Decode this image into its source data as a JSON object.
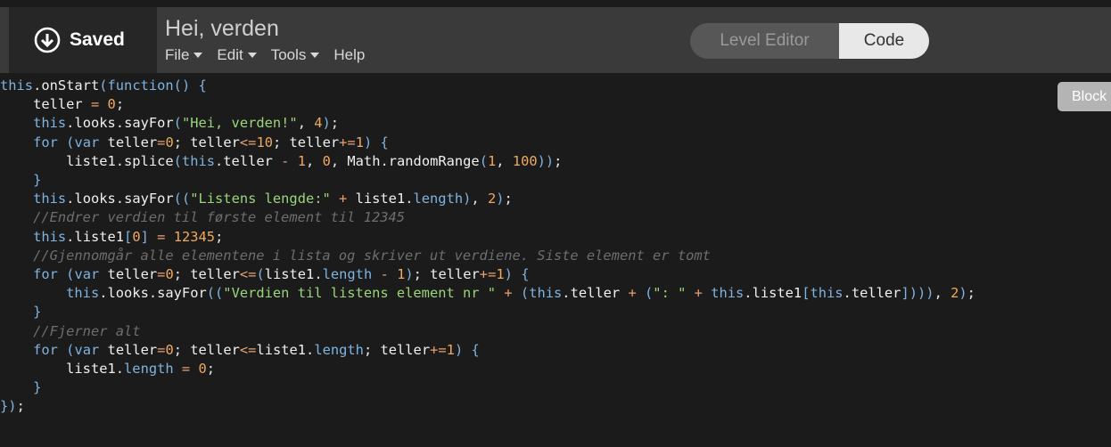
{
  "header": {
    "save_label": "Saved",
    "title": "Hei, verden",
    "menu": [
      {
        "label": "File",
        "has_caret": true
      },
      {
        "label": "Edit",
        "has_caret": true
      },
      {
        "label": "Tools",
        "has_caret": true
      },
      {
        "label": "Help",
        "has_caret": false
      }
    ],
    "toggle": {
      "level_editor": "Level Editor",
      "code": "Code",
      "active": "Code"
    }
  },
  "blocks_button": "Block",
  "code_lines": [
    "this.onStart(function() {",
    "    teller = 0;",
    "    this.looks.sayFor(\"Hei, verden!\", 4);",
    "    for (var teller=0; teller<=10; teller+=1) {",
    "        liste1.splice(this.teller - 1, 0, Math.randomRange(1, 100));",
    "    }",
    "    this.looks.sayFor((\"Listens lengde:\" + liste1.length), 2);",
    "    //Endrer verdien til første element til 12345",
    "    this.liste1[0] = 12345;",
    "    //Gjennomgår alle elementene i lista og skriver ut verdiene. Siste element er tomt",
    "    for (var teller=0; teller<=(liste1.length - 1); teller+=1) {",
    "        this.looks.sayFor((\"Verdien til listens element nr \" + (this.teller + (\": \" + this.liste1[this.teller]))), 2);",
    "    }",
    "    //Fjerner alt",
    "    for (var teller=0; teller<=liste1.length; teller+=1) {",
    "        liste1.length = 0;",
    "    }",
    "});"
  ],
  "colors": {
    "background": "#1b1b1b",
    "topbar": "#3a3a3a",
    "keyword": "#7fb3e0",
    "string": "#9bd57a",
    "number": "#f0a95e",
    "comment": "#6e6e6e"
  }
}
